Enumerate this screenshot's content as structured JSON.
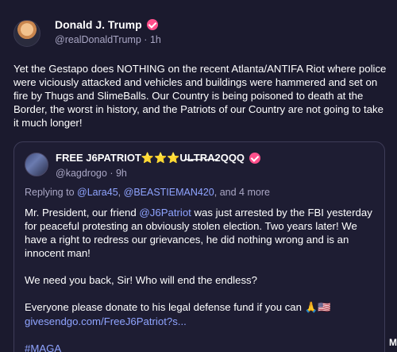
{
  "post": {
    "author": {
      "display_name": "Donald J. Trump",
      "handle": "@realDonaldTrump",
      "time": "1h",
      "separator": "·"
    },
    "text": "Yet the Gestapo does NOTHING on the recent Atlanta/ANTIFA Riot where police were viciously attacked and vehicles and buildings were hammered and set on fire by Thugs and SlimeBalls. Our Country is being poisoned to death at the Border, the worst in history, and the Patriots of our Country are not going to take it much longer!"
  },
  "quote": {
    "author": {
      "display_name": "FREE J6PATRIOT⭐⭐⭐U̶L̶T̶R̶A̶2QQQ",
      "handle": "@kagdrogo",
      "time": "9h",
      "separator": "·"
    },
    "reply": {
      "prefix": "Replying to",
      "user1": "@Lara45",
      "comma": ",",
      "user2": "@BEASTIEMAN420",
      "suffix": ", and 4 more"
    },
    "para1_before": "Mr. President, our friend ",
    "para1_mention": "@J6Patriot",
    "para1_after": " was just arrested by the FBI yesterday for peaceful protesting an obviously stolen election. Two years later! We have a right to redress our grievances, he did nothing wrong and is an innocent man!",
    "para2": "We need you back, Sir! Who will end the endless?",
    "para3_text": "Everyone please donate to his legal defense fund if you can",
    "para3_emoji": "🙏🇺🇸",
    "para3_link": "givesendgo.com/FreeJ6Patriot?s...",
    "hashtag": "#MAGA"
  },
  "edge_letter": "M",
  "icons": [
    "verified-badge-icon",
    "avatar"
  ],
  "colors": {
    "background": "#1b1a2e",
    "verified": "#ff4f8b",
    "link": "#8fa4ff",
    "muted": "#a9a6c4"
  }
}
